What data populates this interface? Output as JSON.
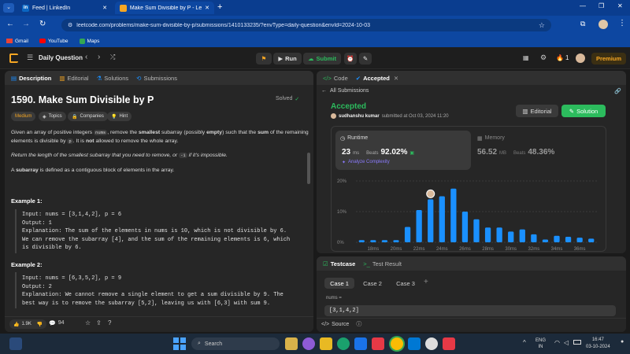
{
  "browser": {
    "tabs": [
      {
        "label": "Feed | LinkedIn",
        "icon": "linkedin-icon"
      },
      {
        "label": "Make Sum Divisible by P - Leet",
        "icon": "leetcode-icon"
      }
    ],
    "url": "leetcode.com/problems/make-sum-divisible-by-p/submissions/1410133235/?envType=daily-question&envId=2024-10-03",
    "bookmarks": [
      "Gmail",
      "YouTube",
      "Maps"
    ]
  },
  "toolbar": {
    "title": "Daily Question",
    "run_label": "Run",
    "submit_label": "Submit",
    "streak": "1",
    "premium_label": "Premium"
  },
  "left_tabs": [
    "Description",
    "Editorial",
    "Solutions",
    "Submissions"
  ],
  "problem": {
    "title": "1590. Make Sum Divisible by P",
    "status": "Solved",
    "difficulty": "Medium",
    "tags": [
      "Topics",
      "Companies",
      "Hint"
    ],
    "p1_a": "Given an array of positive integers",
    "p1_code1": "nums",
    "p1_b": ", remove the",
    "p1_c": "smallest",
    "p1_d": "subarray (possibly",
    "p1_e": "empty",
    "p1_f": ") such that the",
    "p1_g": "sum",
    "p1_h": "of the",
    "p1_line2a": "remaining elements is divisible by",
    "p1_code2": "p",
    "p1_line2b": ". It is",
    "p1_line2c": "not",
    "p1_line2d": "allowed to remove the whole array.",
    "p2_a": "Return the length of the smallest subarray that you need to remove, or",
    "p2_code": "-1",
    "p2_b": "if it's impossible.",
    "p3_a": "A",
    "p3_b": "subarray",
    "p3_c": "is defined as a contiguous block of elements in the array.",
    "ex1_title": "Example 1:",
    "ex1_body": "Input: nums = [3,1,4,2], p = 6\nOutput: 1\nExplanation: The sum of the elements in nums is 10, which is not divisible by 6.\nWe can remove the subarray [4], and the sum of the remaining elements is 6, which\nis divisible by 6.",
    "ex2_title": "Example 2:",
    "ex2_body": "Input: nums = [6,3,5,2], p = 9\nOutput: 2\nExplanation: We cannot remove a single element to get a sum divisible by 9. The\nbest way is to remove the subarray [5,2], leaving us with [6,3] with sum 9.",
    "likes": "1.9K",
    "comments": "94"
  },
  "right_tabs": {
    "code": "Code",
    "accepted": "Accepted"
  },
  "submission": {
    "back_label": "All Submissions",
    "status": "Accepted",
    "user": "sudhanshu kumar",
    "submitted": "submitted at Oct 03, 2024 11:20",
    "editorial_label": "Editorial",
    "solution_label": "Solution",
    "runtime_label": "Runtime",
    "runtime_value": "23",
    "runtime_unit": "ms",
    "beats_label": "Beats",
    "runtime_beats": "92.02%",
    "analyze_label": "Analyze Complexity",
    "memory_label": "Memory",
    "memory_value": "56.52",
    "memory_unit": "MB",
    "memory_beats": "48.36%"
  },
  "chart_data": {
    "type": "bar",
    "y_ticks": [
      "20%",
      "10%",
      "0%"
    ],
    "ylim": [
      0,
      20
    ],
    "x_ticks": [
      "18ms",
      "20ms",
      "22ms",
      "24ms",
      "26ms",
      "28ms",
      "30ms",
      "32ms",
      "34ms",
      "36ms"
    ],
    "x": [
      17,
      18,
      19,
      20,
      21,
      22,
      23,
      24,
      25,
      26,
      27,
      28,
      29,
      30,
      31,
      32,
      33,
      34,
      35,
      36,
      37
    ],
    "values": [
      0.7,
      0.7,
      0.7,
      0.7,
      5,
      10.5,
      14,
      15,
      17.5,
      10,
      7.5,
      4.8,
      4.8,
      3.5,
      4.2,
      2.6,
      0.9,
      2.1,
      1.8,
      1.5,
      1.2
    ],
    "highlight_x": 23,
    "bar_color": "#1a90ff"
  },
  "testcase": {
    "tab1": "Testcase",
    "tab2": "Test Result",
    "cases": [
      "Case 1",
      "Case 2",
      "Case 3"
    ],
    "field_label": "nums =",
    "field_value": "[3,1,4,2]",
    "source_label": "Source"
  },
  "taskbar": {
    "search_placeholder": "Search",
    "lang1": "ENG",
    "lang2": "IN",
    "time": "16:47",
    "date": "03-10-2024"
  }
}
